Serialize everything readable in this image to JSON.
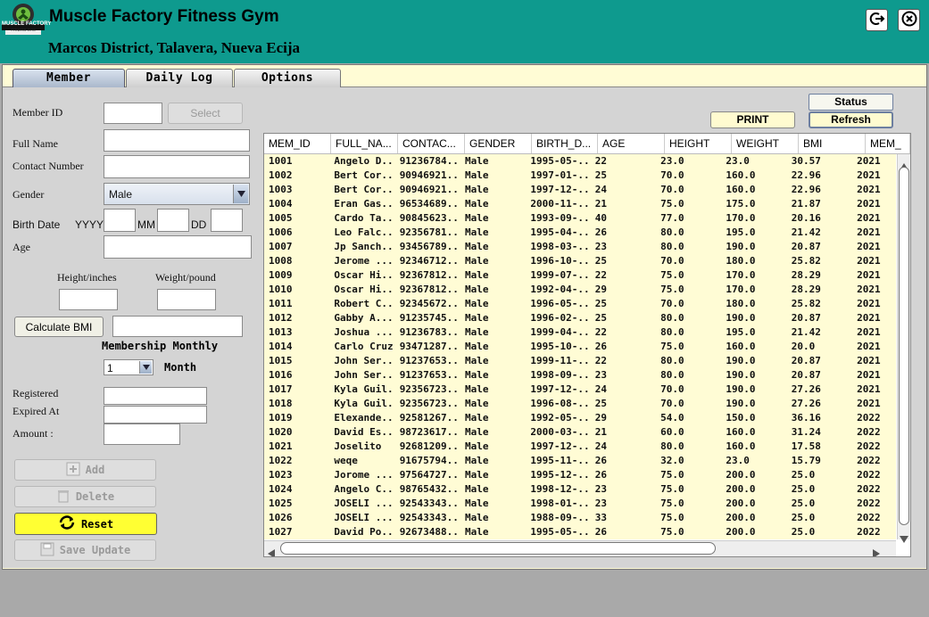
{
  "app": {
    "title": "Muscle Factory Fitness Gym",
    "subtitle": "Marcos District, Talavera, Nueva Ecija",
    "logo_text": "MUSCLE FACTORY",
    "logo_subtext": "FITNESS GYM",
    "header_color": "#0e9a8e"
  },
  "tabs": [
    {
      "label": "Member",
      "active": true
    },
    {
      "label": "Daily Log",
      "active": false
    },
    {
      "label": "Options",
      "active": false
    }
  ],
  "form": {
    "member_id_label": "Member ID",
    "select_button": "Select",
    "full_name_label": "Full Name",
    "contact_label": "Contact Number",
    "gender_label": "Gender",
    "gender_value": "Male",
    "birth_date_label": "Birth Date",
    "yyyy_label": "YYYY",
    "mm_label": "MM",
    "dd_label": "DD",
    "age_label": "Age",
    "height_label": "Height/inches",
    "weight_label": "Weight/pound",
    "calculate_bmi_button": "Calculate BMI",
    "membership_label": "Membership Monthly",
    "month_value": "1",
    "month_label": "Month",
    "registered_label": "Registered",
    "expired_label": "Expired At",
    "amount_label": "Amount :"
  },
  "actions": {
    "add": "Add",
    "delete": "Delete",
    "reset": "Reset",
    "save_update": "Save Update",
    "reset_color": "#ffff33"
  },
  "toolbar": {
    "status": "Status",
    "print": "PRINT",
    "refresh": "Refresh"
  },
  "table": {
    "columns": [
      "MEM_ID",
      "FULL_NA...",
      "CONTAC...",
      "GENDER",
      "BIRTH_D...",
      "AGE",
      "HEIGHT",
      "WEIGHT",
      "BMI",
      "MEM_"
    ],
    "rows": [
      [
        "1001",
        "Angelo D...",
        "91236784...",
        "Male",
        "1995-05-...",
        "22",
        "23.0",
        "23.0",
        "30.57",
        "2021"
      ],
      [
        "1002",
        "Bert Cor...",
        "90946921...",
        "Male",
        "1997-01-...",
        "25",
        "70.0",
        "160.0",
        "22.96",
        "2021"
      ],
      [
        "1003",
        "Bert Cor...",
        "90946921...",
        "Male",
        "1997-12-...",
        "24",
        "70.0",
        "160.0",
        "22.96",
        "2021"
      ],
      [
        "1004",
        "Eran Gas...",
        "96534689...",
        "Male",
        "2000-11-...",
        "21",
        "75.0",
        "175.0",
        "21.87",
        "2021"
      ],
      [
        "1005",
        "Cardo Ta...",
        "90845623...",
        "Male",
        "1993-09-...",
        "40",
        "77.0",
        "170.0",
        "20.16",
        "2021"
      ],
      [
        "1006",
        "Leo Falc...",
        "92356781...",
        "Male",
        "1995-04-...",
        "26",
        "80.0",
        "195.0",
        "21.42",
        "2021"
      ],
      [
        "1007",
        "Jp Sanch...",
        "93456789...",
        "Male",
        "1998-03-...",
        "23",
        "80.0",
        "190.0",
        "20.87",
        "2021"
      ],
      [
        "1008",
        "Jerome ...",
        "92346712...",
        "Male",
        "1996-10-...",
        "25",
        "70.0",
        "180.0",
        "25.82",
        "2021"
      ],
      [
        "1009",
        "Oscar Hi...",
        "92367812...",
        "Male",
        "1999-07-...",
        "22",
        "75.0",
        "170.0",
        "28.29",
        "2021"
      ],
      [
        "1010",
        "Oscar Hi...",
        "92367812...",
        "Male",
        "1992-04-...",
        "29",
        "75.0",
        "170.0",
        "28.29",
        "2021"
      ],
      [
        "1011",
        "Robert C...",
        "92345672...",
        "Male",
        "1996-05-...",
        "25",
        "70.0",
        "180.0",
        "25.82",
        "2021"
      ],
      [
        "1012",
        "Gabby A...",
        "91235745...",
        "Male",
        "1996-02-...",
        "25",
        "80.0",
        "190.0",
        "20.87",
        "2021"
      ],
      [
        "1013",
        "Joshua ...",
        "91236783...",
        "Male",
        "1999-04-...",
        "22",
        "80.0",
        "195.0",
        "21.42",
        "2021"
      ],
      [
        "1014",
        "Carlo Cruz",
        "93471287...",
        "Male",
        "1995-10-...",
        "26",
        "75.0",
        "160.0",
        "20.0",
        "2021"
      ],
      [
        "1015",
        "John Ser...",
        "91237653...",
        "Male",
        "1999-11-...",
        "22",
        "80.0",
        "190.0",
        "20.87",
        "2021"
      ],
      [
        "1016",
        "John Ser...",
        "91237653...",
        "Male",
        "1998-09-...",
        "23",
        "80.0",
        "190.0",
        "20.87",
        "2021"
      ],
      [
        "1017",
        "Kyla Guil...",
        "92356723...",
        "Male",
        "1997-12-...",
        "24",
        "70.0",
        "190.0",
        "27.26",
        "2021"
      ],
      [
        "1018",
        "Kyla Guil...",
        "92356723...",
        "Male",
        "1996-08-...",
        "25",
        "70.0",
        "190.0",
        "27.26",
        "2021"
      ],
      [
        "1019",
        "Elexande...",
        "92581267...",
        "Male",
        "1992-05-...",
        "29",
        "54.0",
        "150.0",
        "36.16",
        "2022"
      ],
      [
        "1020",
        "David Es...",
        "98723617...",
        "Male",
        "2000-03-...",
        "21",
        "60.0",
        "160.0",
        "31.24",
        "2022"
      ],
      [
        "1021",
        "Joselito",
        "92681209...",
        "Male",
        "1997-12-...",
        "24",
        "80.0",
        "160.0",
        "17.58",
        "2022"
      ],
      [
        "1022",
        "weqe",
        "91675794...",
        "Male",
        "1995-11-...",
        "26",
        "32.0",
        "23.0",
        "15.79",
        "2022"
      ],
      [
        "1023",
        "Jorome ...",
        "97564727...",
        "Male",
        "1995-12-...",
        "26",
        "75.0",
        "200.0",
        "25.0",
        "2022"
      ],
      [
        "1024",
        "Angelo C...",
        "98765432...",
        "Male",
        "1998-12-...",
        "23",
        "75.0",
        "200.0",
        "25.0",
        "2022"
      ],
      [
        "1025",
        "JOSELI ...",
        "92543343...",
        "Male",
        "1998-01-...",
        "23",
        "75.0",
        "200.0",
        "25.0",
        "2022"
      ],
      [
        "1026",
        "JOSELI ...",
        "92543343...",
        "Male",
        "1988-09-...",
        "33",
        "75.0",
        "200.0",
        "25.0",
        "2022"
      ],
      [
        "1027",
        "David Po...",
        "92673488...",
        "Male",
        "1995-05-...",
        "26",
        "75.0",
        "200.0",
        "25.0",
        "2022"
      ]
    ]
  }
}
